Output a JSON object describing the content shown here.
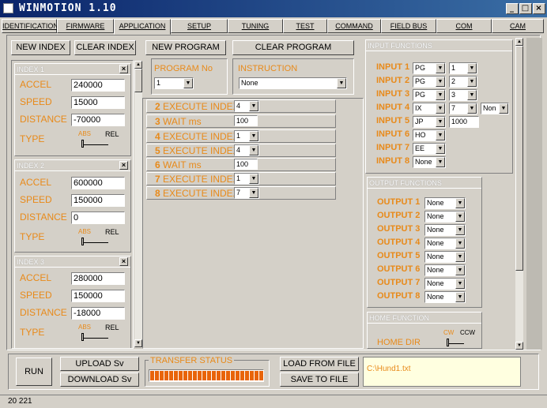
{
  "window": {
    "title": "WINMOTION 1.10",
    "min": "_",
    "max": "□",
    "close": "×"
  },
  "tabs": [
    "IDENTIFICATION",
    "FIRMWARE",
    "APPLICATION",
    "SETUP",
    "TUNING",
    "TEST",
    "COMMAND",
    "FIELD BUS",
    "COM",
    "CAM"
  ],
  "left": {
    "new_index": "NEW INDEX",
    "clear_index": "CLEAR INDEX",
    "indexes": [
      {
        "title": "INDEX 1",
        "accel": "240000",
        "speed": "15000",
        "distance": "-70000"
      },
      {
        "title": "INDEX 2",
        "accel": "600000",
        "speed": "150000",
        "distance": "0"
      },
      {
        "title": "INDEX 3",
        "accel": "280000",
        "speed": "150000",
        "distance": "-18000"
      }
    ],
    "labels": {
      "accel": "ACCEL",
      "speed": "SPEED",
      "distance": "DISTANCE",
      "type": "TYPE",
      "abs": "ABS",
      "rel": "REL"
    }
  },
  "middle": {
    "new_program": "NEW PROGRAM",
    "clear_program": "CLEAR PROGRAM",
    "program_no_label": "PROGRAM No",
    "program_no_value": "1",
    "instruction_label": "INSTRUCTION",
    "instruction_value": "None",
    "instructions": [
      {
        "num": "2",
        "name": "EXECUTE INDEX",
        "value": "4",
        "kind": "select"
      },
      {
        "num": "3",
        "name": "WAIT ms",
        "value": "100",
        "kind": "field"
      },
      {
        "num": "4",
        "name": "EXECUTE INDEX",
        "value": "1",
        "kind": "select"
      },
      {
        "num": "5",
        "name": "EXECUTE INDEX",
        "value": "4",
        "kind": "select"
      },
      {
        "num": "6",
        "name": "WAIT ms",
        "value": "100",
        "kind": "field"
      },
      {
        "num": "7",
        "name": "EXECUTE INDEX",
        "value": "1",
        "kind": "select"
      },
      {
        "num": "8",
        "name": "EXECUTE INDEX",
        "value": "7",
        "kind": "select"
      }
    ]
  },
  "right": {
    "input_title": "INPUT FUNCTIONS",
    "inputs": [
      {
        "label": "INPUT 1",
        "a": "PG",
        "b": "1"
      },
      {
        "label": "INPUT 2",
        "a": "PG",
        "b": "2"
      },
      {
        "label": "INPUT 3",
        "a": "PG",
        "b": "3"
      },
      {
        "label": "INPUT 4",
        "a": "IX",
        "b": "7",
        "c": "Non"
      },
      {
        "label": "INPUT 5",
        "a": "JP",
        "d": "1000"
      },
      {
        "label": "INPUT 6",
        "a": "HO"
      },
      {
        "label": "INPUT 7",
        "a": "EE"
      },
      {
        "label": "INPUT 8",
        "a": "None"
      }
    ],
    "output_title": "OUTPUT FUNCTIONS",
    "outputs": [
      {
        "label": "OUTPUT 1",
        "a": "None"
      },
      {
        "label": "OUTPUT 2",
        "a": "None"
      },
      {
        "label": "OUTPUT 3",
        "a": "None"
      },
      {
        "label": "OUTPUT 4",
        "a": "None"
      },
      {
        "label": "OUTPUT 5",
        "a": "None"
      },
      {
        "label": "OUTPUT 6",
        "a": "None"
      },
      {
        "label": "OUTPUT 7",
        "a": "None"
      },
      {
        "label": "OUTPUT 8",
        "a": "None"
      }
    ],
    "home_title": "HOME FUNCTION",
    "home_dir": "HOME DIR",
    "cw": "CW",
    "ccw": "CCW"
  },
  "bottom": {
    "run": "RUN",
    "upload": "UPLOAD Sv",
    "download": "DOWNLOAD Sv",
    "transfer": "TRANSFER STATUS",
    "load": "LOAD FROM FILE",
    "save": "SAVE TO FILE",
    "file_path": "C:\\Hund1.txt",
    "progress": 1.0
  },
  "statusbar": "20 221",
  "colors": {
    "label": "#e88a1a",
    "progress": "#e8640a"
  }
}
